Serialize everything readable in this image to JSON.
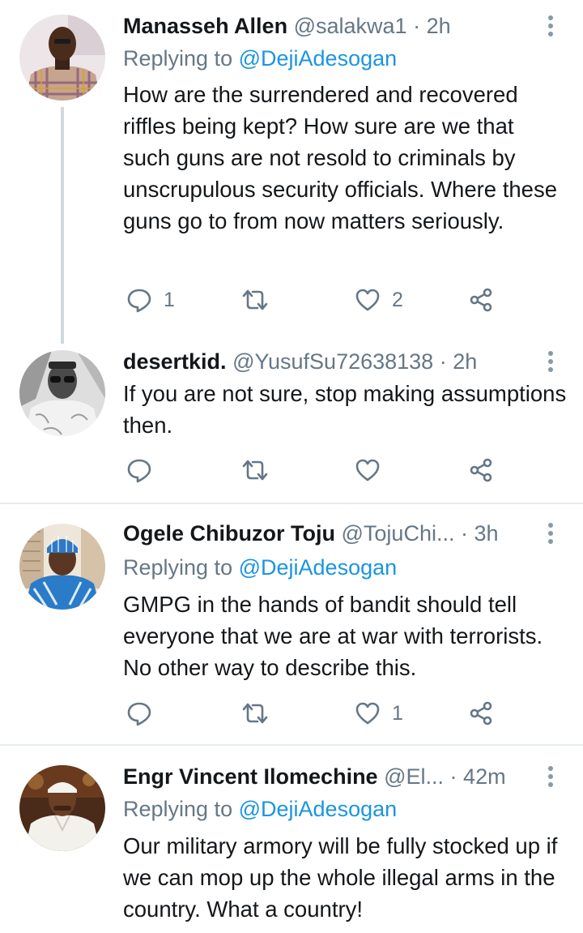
{
  "tweets": [
    {
      "name": "Manasseh Allen",
      "handle": "@salakwa1",
      "dot": "·",
      "time": "2h",
      "replying_prefix": "Replying to",
      "replying_to": "@DejiAdesogan",
      "text": "How are the surrendered and recovered riffles being kept? How sure are we that such guns are not resold to criminals by unscrupulous security officials.  Where these guns go to from now matters seriously.",
      "reply_count": "1",
      "retweet_count": "",
      "like_count": "2",
      "avatar_icon": "avatar-man-checked-shirt"
    },
    {
      "name": "desertkid.",
      "handle": "@YusufSu72638138",
      "dot": "·",
      "time": "2h",
      "text": "If you are not sure, stop making assumptions then.",
      "reply_count": "",
      "retweet_count": "",
      "like_count": "",
      "avatar_icon": "avatar-man-sunglasses-bw"
    },
    {
      "name": "Ogele Chibuzor Toju",
      "handle": "@TojuChi...",
      "dot": "·",
      "time": "3h",
      "replying_prefix": "Replying to",
      "replying_to": "@DejiAdesogan",
      "text": "GMPG in the hands of bandit should tell everyone that we are at war with terrorists. No other way to describe this.",
      "reply_count": "",
      "retweet_count": "",
      "like_count": "1",
      "avatar_icon": "avatar-man-blue-cap"
    },
    {
      "name": "Engr Vincent Ilomechine",
      "handle": "@El...",
      "dot": "·",
      "time": "42m",
      "replying_prefix": "Replying to",
      "replying_to": "@DejiAdesogan",
      "text": "Our military armory will be fully stocked up if we can mop up the whole illegal arms in the country. What a country!",
      "avatar_icon": "avatar-man-white-cap"
    }
  ],
  "colors": {
    "text": "#14171a",
    "secondary": "#657786",
    "link": "#1b95e0",
    "divider": "#e6ecf0",
    "thread_line": "#cfd9de"
  }
}
